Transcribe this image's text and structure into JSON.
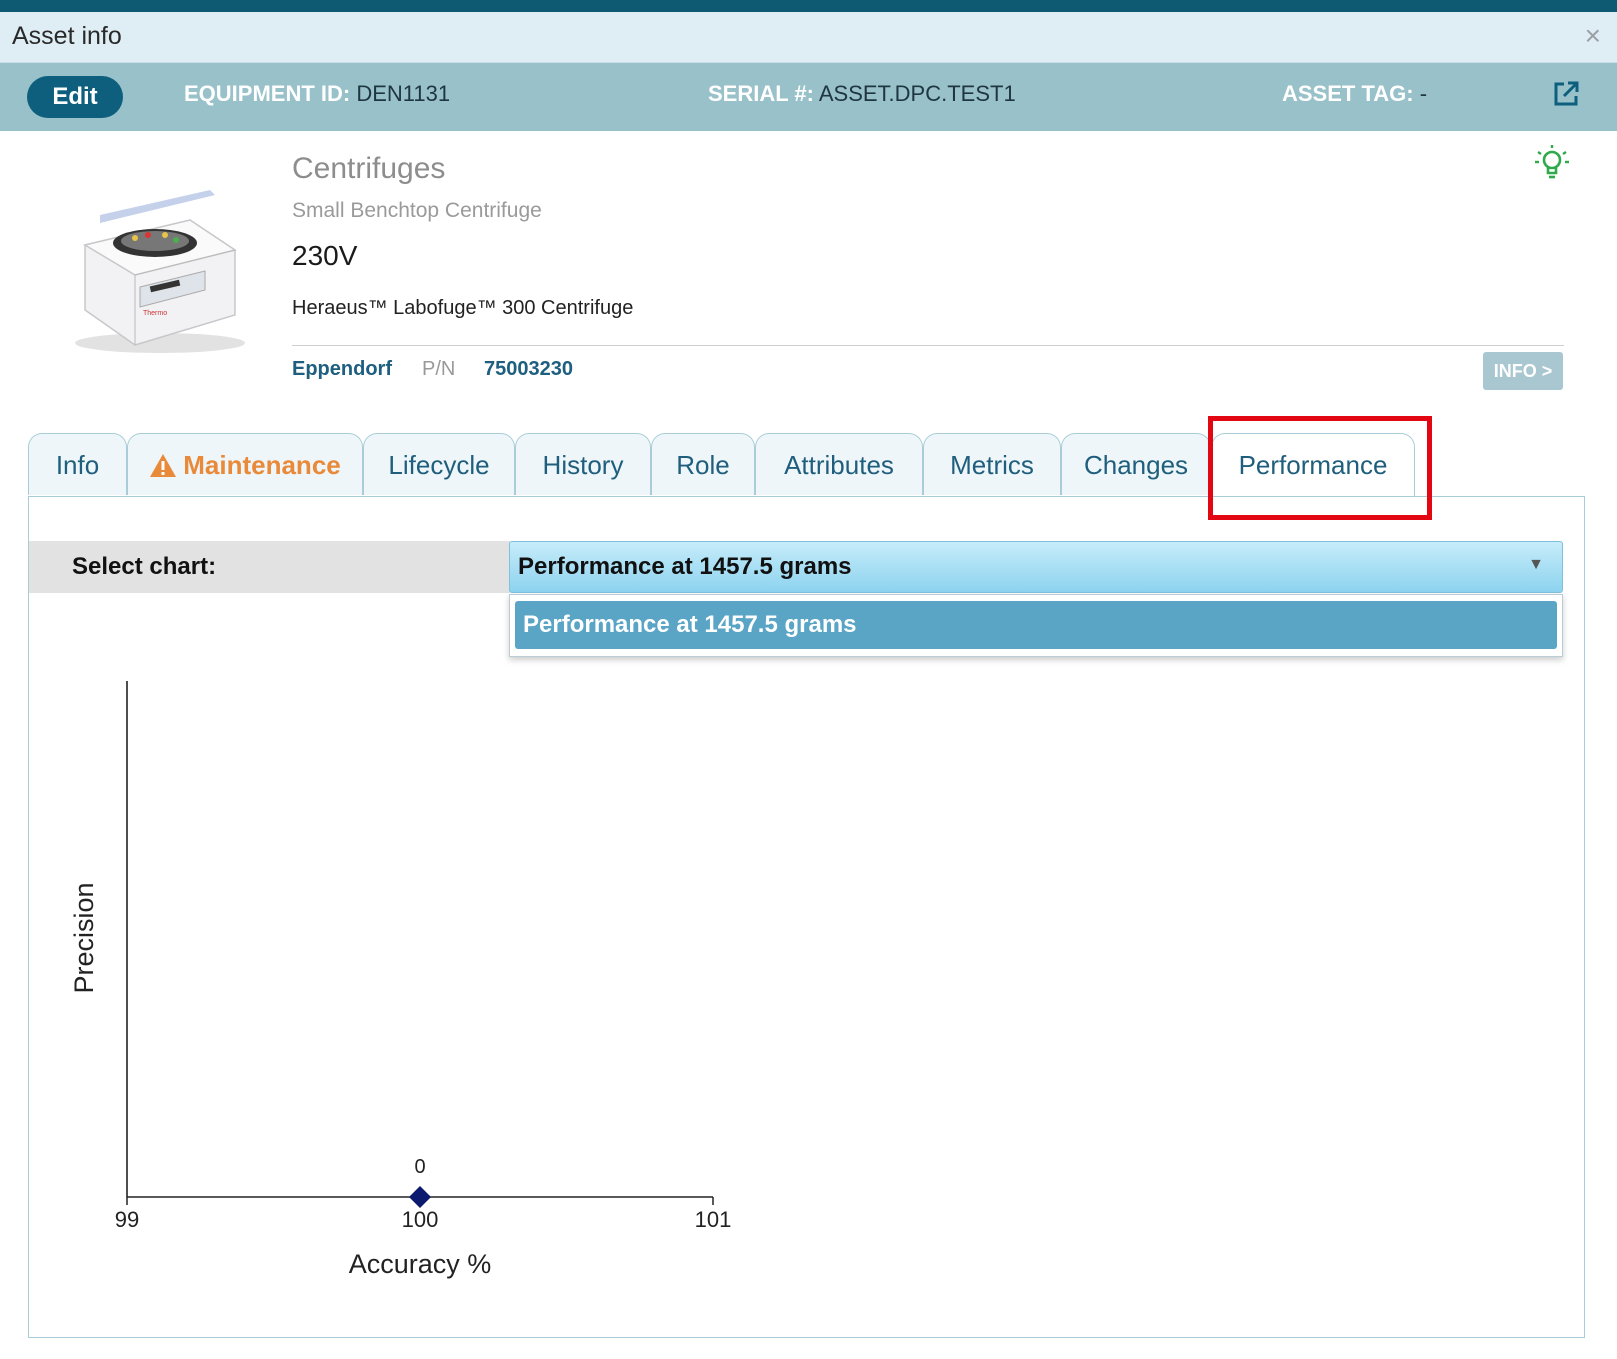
{
  "window": {
    "title": "Asset info",
    "close_glyph": "×"
  },
  "header": {
    "edit_label": "Edit",
    "equipment_id_label": "EQUIPMENT ID:",
    "equipment_id": "DEN1131",
    "serial_label": "SERIAL #:",
    "serial": "ASSET.DPC.TEST1",
    "asset_tag_label": "ASSET TAG:",
    "asset_tag": "-",
    "icons": [
      "external-link-icon",
      "lightbulb-icon"
    ],
    "colors": {
      "header_bg": "#98c1ca",
      "edit_bg": "#0d5f7d",
      "bulb": "#2eaa4a"
    }
  },
  "product": {
    "category": "Centrifuges",
    "subcategory": "Small Benchtop Centrifuge",
    "voltage": "230V",
    "model": "Heraeus™ Labofuge™ 300 Centrifuge",
    "manufacturer": "Eppendorf",
    "pn_label": "P/N",
    "pn": "75003230",
    "info_button": "INFO >"
  },
  "tabs": [
    {
      "label": "Info"
    },
    {
      "label": "Maintenance",
      "icon": "warning-icon",
      "warning": true
    },
    {
      "label": "Lifecycle"
    },
    {
      "label": "History"
    },
    {
      "label": "Role"
    },
    {
      "label": "Attributes"
    },
    {
      "label": "Metrics"
    },
    {
      "label": "Changes"
    },
    {
      "label": "Performance",
      "active": true,
      "highlighted": true
    }
  ],
  "performance": {
    "select_label": "Select chart:",
    "selected": "Performance at 1457.5 grams",
    "options": [
      "Performance at 1457.5 grams"
    ]
  },
  "chart_data": {
    "type": "scatter",
    "xlabel": "Accuracy %",
    "ylabel": "Precision",
    "xlim": [
      99,
      101
    ],
    "x_ticks": [
      "99",
      "100",
      "101"
    ],
    "points": [
      {
        "x": 100,
        "y": 0,
        "label": "0"
      }
    ],
    "marker": "diamond",
    "marker_color": "#0b1a6e"
  }
}
